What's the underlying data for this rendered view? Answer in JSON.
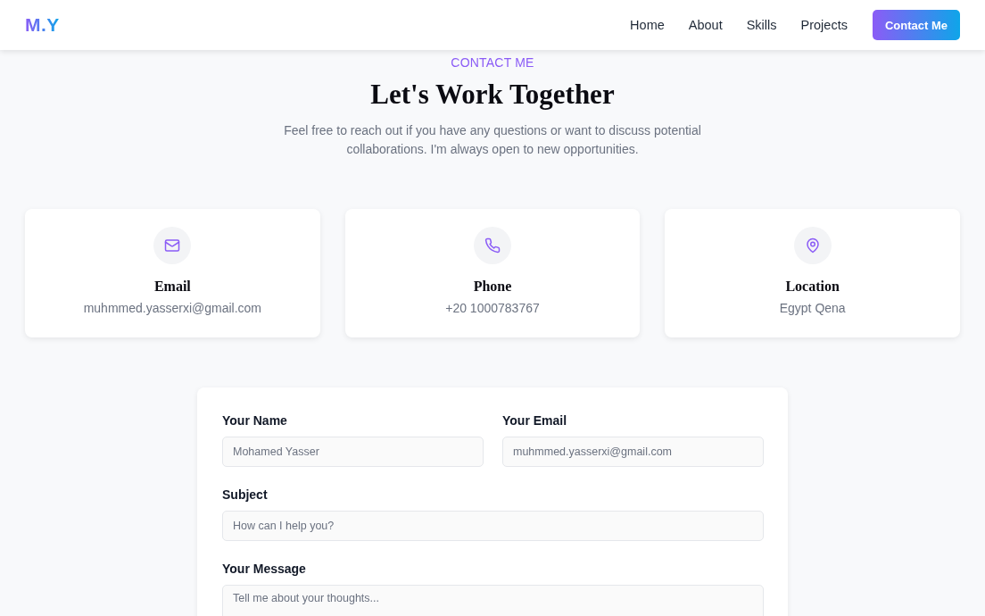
{
  "header": {
    "logo": "M.Y",
    "nav": [
      {
        "label": "Home"
      },
      {
        "label": "About"
      },
      {
        "label": "Skills"
      },
      {
        "label": "Projects"
      }
    ],
    "cta": "Contact Me"
  },
  "intro": {
    "eyebrow": "CONTACT ME",
    "title": "Let's Work Together",
    "description": "Feel free to reach out if you have any questions or want to discuss potential collaborations. I'm always open to new opportunities."
  },
  "contact_cards": [
    {
      "kind": "email",
      "title": "Email",
      "value": "muhmmed.yasserxi@gmail.com"
    },
    {
      "kind": "phone",
      "title": "Phone",
      "value": "+20 1000783767"
    },
    {
      "kind": "location",
      "title": "Location",
      "value": "Egypt Qena"
    }
  ],
  "form": {
    "rows": [
      {
        "fields": [
          {
            "kind": "text",
            "label": "Your Name",
            "placeholder": "Mohamed Yasser"
          },
          {
            "kind": "text",
            "label": "Your Email",
            "placeholder": "muhmmed.yasserxi@gmail.com"
          }
        ]
      },
      {
        "fields": [
          {
            "kind": "text",
            "label": "Subject",
            "placeholder": "How can I help you?"
          }
        ]
      },
      {
        "fields": [
          {
            "kind": "textarea",
            "label": "Your Message",
            "placeholder": "Tell me about your thoughts..."
          }
        ]
      }
    ]
  }
}
